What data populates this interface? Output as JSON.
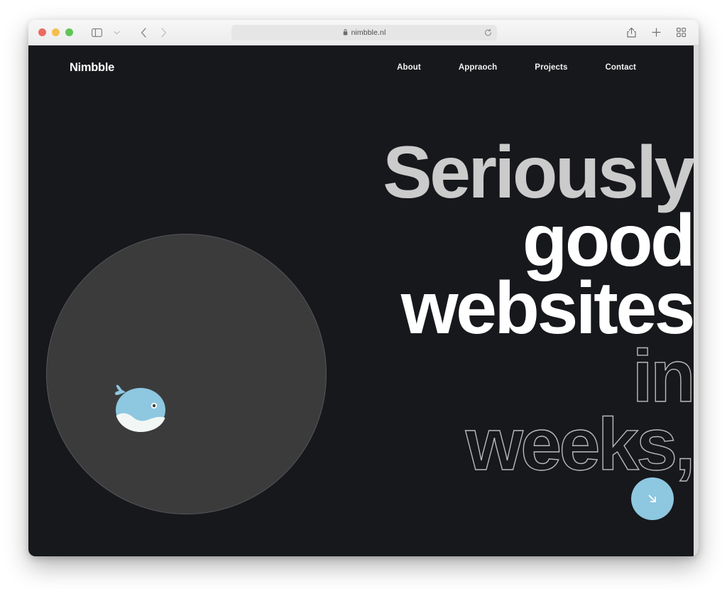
{
  "browser": {
    "url": "nimbble.nl",
    "icons": {
      "lock": "lock-icon",
      "reload": "reload-icon",
      "sidebar": "sidebar-toggle-icon",
      "chevron_down": "chevron-down-icon",
      "back": "back-arrow-icon",
      "forward": "forward-arrow-icon",
      "shield": "privacy-shield-icon",
      "share": "share-icon",
      "new_tab": "plus-icon",
      "tab_overview": "tab-overview-icon"
    },
    "traffic_lights": [
      "close",
      "minimize",
      "maximize"
    ]
  },
  "site": {
    "logo": "Nimbble",
    "nav": [
      {
        "label": "About"
      },
      {
        "label": "Appraoch"
      },
      {
        "label": "Projects"
      },
      {
        "label": "Contact"
      }
    ],
    "headline": {
      "line1": "Seriously",
      "line2": "good",
      "line3": "websites",
      "line4": "in",
      "line5": "weeks,"
    },
    "scroll_button": "scroll-down-arrow",
    "illustration": "whale-illustration"
  },
  "colors": {
    "page_background": "#16181b",
    "circle": "#3b3b3c",
    "accent_blue": "#8ec7e0",
    "headline_gray": "#cbcbcb",
    "headline_white": "#ffffff",
    "outline_stroke": "#b9b9b9",
    "whale_body": "#8ec7e0",
    "whale_belly": "#f2f7f5"
  }
}
